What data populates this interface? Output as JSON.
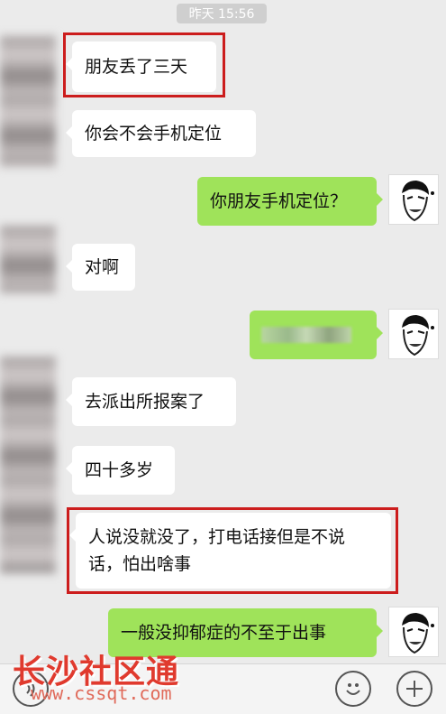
{
  "timestamp": "昨天 15:56",
  "messages": [
    {
      "side": "left",
      "text": "朋友丢了三天",
      "highlight": true
    },
    {
      "side": "left",
      "text": "你会不会手机定位"
    },
    {
      "side": "right",
      "text": "你朋友手机定位？"
    },
    {
      "side": "left",
      "text": "对啊"
    },
    {
      "side": "right",
      "text": "",
      "mosaic": true
    },
    {
      "side": "left",
      "text": "去派出所报案了"
    },
    {
      "side": "left",
      "text": "四十多岁"
    },
    {
      "side": "left",
      "text_line1": "人说没就没了，打电话接但是不说",
      "text_line2": "话，怕出啥事",
      "highlight": true
    },
    {
      "side": "right",
      "text": "一般没抑郁症的不至于出事"
    }
  ],
  "watermark": {
    "name": "长沙社区通",
    "url": "www.cssqt.com"
  },
  "icons": {
    "emoji": "emoji-icon",
    "plus": "plus-icon",
    "voice": "voice-icon"
  },
  "colors": {
    "background": "#ebebeb",
    "sent_bubble": "#9fe35a",
    "received_bubble": "#ffffff",
    "highlight_box": "#cc1d1d",
    "watermark": "#e03a2e"
  }
}
